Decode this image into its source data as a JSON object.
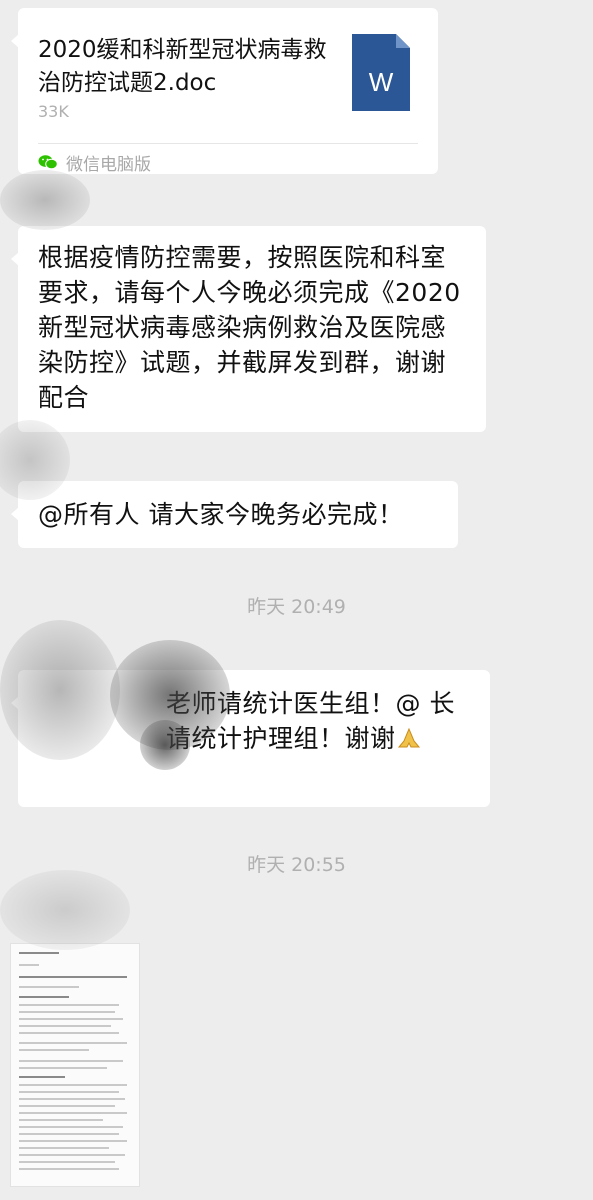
{
  "file_message": {
    "file_name": "2020缓和科新型冠状病毒救治防控试题2.doc",
    "file_size": "33K",
    "source": "微信电脑版",
    "file_icon_letter": "W",
    "file_icon_color": "#2b5797"
  },
  "notice_message": {
    "text": "根据疫情防控需要，按照医院和科室要求，请每个人今晚必须完成《2020新型冠状病毒感染病例救治及医院感染防控》试题，并截屏发到群，谢谢配合"
  },
  "mention_message": {
    "text": "@所有人 请大家今晚务必完成！"
  },
  "timestamp_1": "昨天 20:49",
  "request_message": {
    "text": "老师请统计医生组！@       长请统计护理组！谢谢"
  },
  "timestamp_2": "昨天 20:55",
  "image_message": {
    "icon": "document-screenshot-thumbnail"
  },
  "colors": {
    "background": "#ededed",
    "bubble": "#ffffff",
    "timestamp": "#b0b0b0",
    "wechat_green": "#2dc100"
  }
}
